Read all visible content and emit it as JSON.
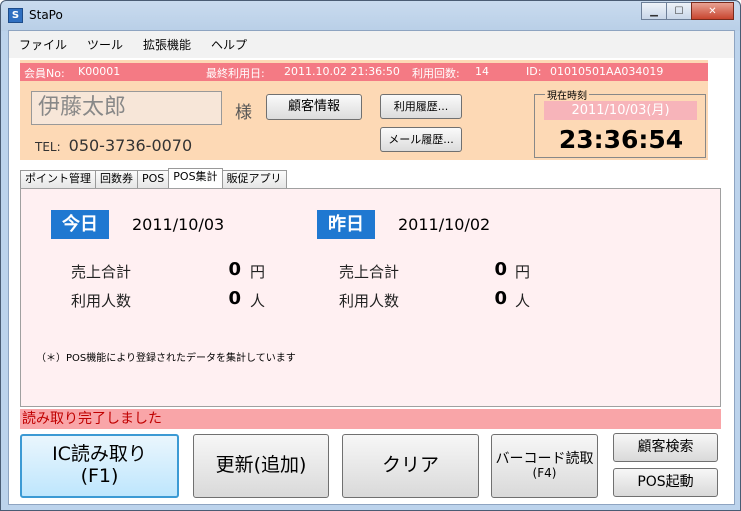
{
  "window": {
    "title": "StaPo",
    "icon": "app-icon",
    "controls": [
      "minimize-icon",
      "maximize-icon",
      "close-icon"
    ]
  },
  "menu": [
    "ファイル",
    "ツール",
    "拡張機能",
    "ヘルプ"
  ],
  "customer": {
    "member_no_label": "会員No:",
    "member_no": "K00001",
    "last_use_label": "最終利用日:",
    "last_use": "2011.10.02 21:36:50",
    "use_count_label": "利用回数:",
    "use_count": "14",
    "id_label": "ID:",
    "id": "01010501AA034019",
    "name": "伊藤太郎",
    "honorific": "様",
    "tel_label": "TEL:",
    "tel": "050-3736-0070",
    "info_button": "顧客情報",
    "history_button": "利用履歴...",
    "mail_history_button": "メール履歴..."
  },
  "clock": {
    "legend": "現在時刻",
    "date": "2011/10/03(月)",
    "time": "23:36:54"
  },
  "tabs": [
    {
      "label": "ポイント管理",
      "active": false
    },
    {
      "label": "回数券",
      "active": false
    },
    {
      "label": "POS",
      "active": false
    },
    {
      "label": "POS集計",
      "active": true
    },
    {
      "label": "販促アプリ",
      "active": false
    }
  ],
  "pos_summary": {
    "today": {
      "badge": "今日",
      "date": "2011/10/03",
      "sales_label": "売上合計",
      "sales": "0",
      "sales_unit": "円",
      "visitors_label": "利用人数",
      "visitors": "0",
      "visitors_unit": "人"
    },
    "yesterday": {
      "badge": "昨日",
      "date": "2011/10/02",
      "sales_label": "売上合計",
      "sales": "0",
      "sales_unit": "円",
      "visitors_label": "利用人数",
      "visitors": "0",
      "visitors_unit": "人"
    },
    "note": "（＊）POS機能により登録されたデータを集計しています"
  },
  "status": "読み取り完了しました",
  "actions": {
    "ic_read": "IC読み取り",
    "ic_read_key": "(F1)",
    "update": "更新(追加)",
    "clear": "クリア",
    "barcode": "バーコード読取",
    "barcode_key": "(F4)",
    "customer_search": "顧客検索",
    "pos_launch": "POS起動"
  },
  "colors": {
    "header_strip": "#f47a84",
    "customer_bg": "#fdd9b5",
    "day_badge": "#1f78d1",
    "status_bg": "#f9a5a8",
    "status_text": "#c00000"
  }
}
